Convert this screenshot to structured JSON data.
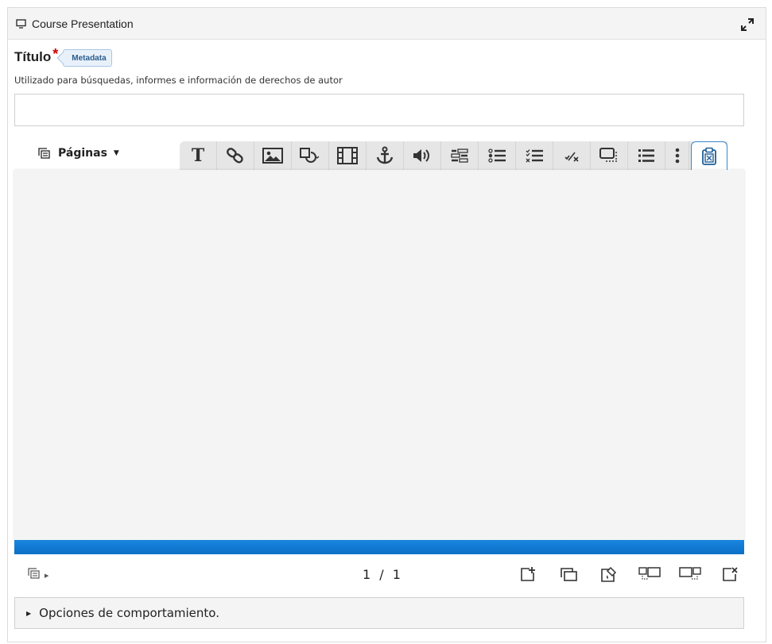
{
  "panel": {
    "title": "Course Presentation",
    "header_icon": "monitor-icon",
    "expand_icon": "expand-icon"
  },
  "title_field": {
    "label": "Título",
    "required_mark": "*",
    "metadata_label": "Metadata",
    "description": "Utilizado para búsquedas, informes e información de derechos de autor",
    "value": "",
    "placeholder": ""
  },
  "pages_menu": {
    "label": "Páginas",
    "icon": "pages-icon"
  },
  "toolbar": {
    "tools": [
      "text-icon",
      "link-icon",
      "image-icon",
      "shapes-icon",
      "video-icon",
      "anchor-icon",
      "audio-icon",
      "fill-in-blanks-icon",
      "single-choice-icon",
      "multi-choice-icon",
      "true-false-icon",
      "drag-text-icon",
      "summary-icon",
      "more-icon",
      "paste-icon"
    ]
  },
  "footer": {
    "current_page": "1",
    "separator": "/",
    "total_pages": "1",
    "actions": [
      "add-slide-icon",
      "clone-slide-icon",
      "slide-background-icon",
      "move-slide-left-icon",
      "move-slide-right-icon",
      "delete-slide-icon"
    ]
  },
  "options": {
    "label": "Opciones de comportamiento."
  },
  "colors": {
    "progress": "#0b6fc6",
    "required": "#cc0000",
    "metadata_bg": "#e8f1fa",
    "active_border": "#3a87c8"
  }
}
